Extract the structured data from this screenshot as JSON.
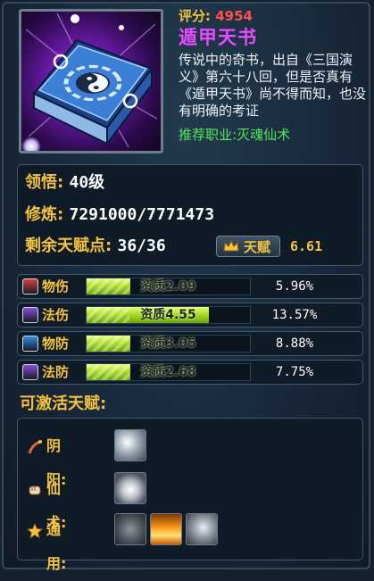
{
  "item": {
    "rating_label": "评分:",
    "rating_value": "4954",
    "name": "遁甲天书",
    "description": "传说中的奇书，出自《三国演义》第六十八回，但是否真有《遁甲天书》尚不得而知，也没有明确的考证",
    "recommend_label": "推荐职业:",
    "recommend_value": "灭魂仙术"
  },
  "stats": {
    "insight_label": "领悟:",
    "insight_value": "40级",
    "cultivation_label": "修炼:",
    "cultivation_value": "7291000/7771473",
    "remaining_label": "剩余天赋点:",
    "remaining_value": "36/36",
    "talent_button": "天赋",
    "talent_value": "6.61"
  },
  "attributes": [
    {
      "name": "物伤",
      "quality": "资质2.09",
      "percent": "5.96%",
      "fill": 0.27,
      "icon_color": "#d9413a"
    },
    {
      "name": "法伤",
      "quality": "资质4.55",
      "percent": "13.57%",
      "fill": 0.75,
      "icon_color": "#8a4fd8"
    },
    {
      "name": "物防",
      "quality": "资质3.05",
      "percent": "8.88%",
      "fill": 0.27,
      "icon_color": "#2f8fe0"
    },
    {
      "name": "法防",
      "quality": "资质2.68",
      "percent": "7.75%",
      "fill": 0.27,
      "icon_color": "#8a4fd8"
    }
  ],
  "talents": {
    "title": "可激活天赋:",
    "rows": [
      {
        "label": "阴阳:",
        "icon": "ribbon-icon",
        "skills": [
          "wind-slash-skill-icon"
        ]
      },
      {
        "label": "仙术:",
        "icon": "fist-icon",
        "skills": [
          "burst-skill-icon"
        ]
      },
      {
        "label": "通用:",
        "icon": "star-icon",
        "skills": [
          "armor-skill-icon",
          "golden-aura-skill-icon",
          "wolf-skill-icon"
        ]
      }
    ]
  },
  "colors": {
    "gold": "#f3c23f",
    "rating_red": "#ff5050",
    "name_purple": "#e94bff",
    "recommend_green": "#52e85a",
    "bar_green": "#9fd31a"
  }
}
